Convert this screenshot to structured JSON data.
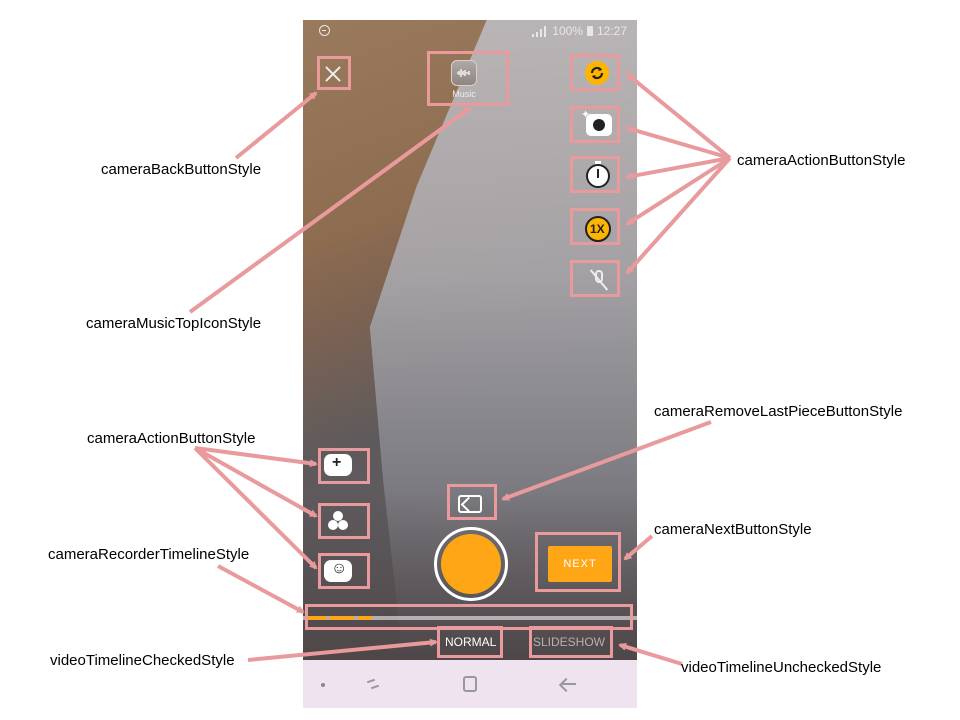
{
  "status_bar": {
    "battery": "100%",
    "time": "12:27"
  },
  "camera": {
    "music_label": "Music",
    "speed_label": "1X",
    "next_label": "NEXT",
    "modes": {
      "checked": "NORMAL",
      "unchecked": "SLIDESHOW"
    },
    "timeline_segments": 3
  },
  "annotations": {
    "back_button": "cameraBackButtonStyle",
    "music_top_icon": "cameraMusicTopIconStyle",
    "action_button_right": "cameraActionButtonStyle",
    "action_button_left": "cameraActionButtonStyle",
    "remove_last_piece": "cameraRemoveLastPieceButtonStyle",
    "next_button": "cameraNextButtonStyle",
    "recorder_timeline": "cameraRecorderTimelineStyle",
    "timeline_checked": "videoTimelineCheckedStyle",
    "timeline_unchecked": "videoTimelineUncheckedStyle"
  },
  "colors": {
    "accent": "#ffa617",
    "annotation": "#e89a9c",
    "nav_bar": "#efe3ef"
  }
}
